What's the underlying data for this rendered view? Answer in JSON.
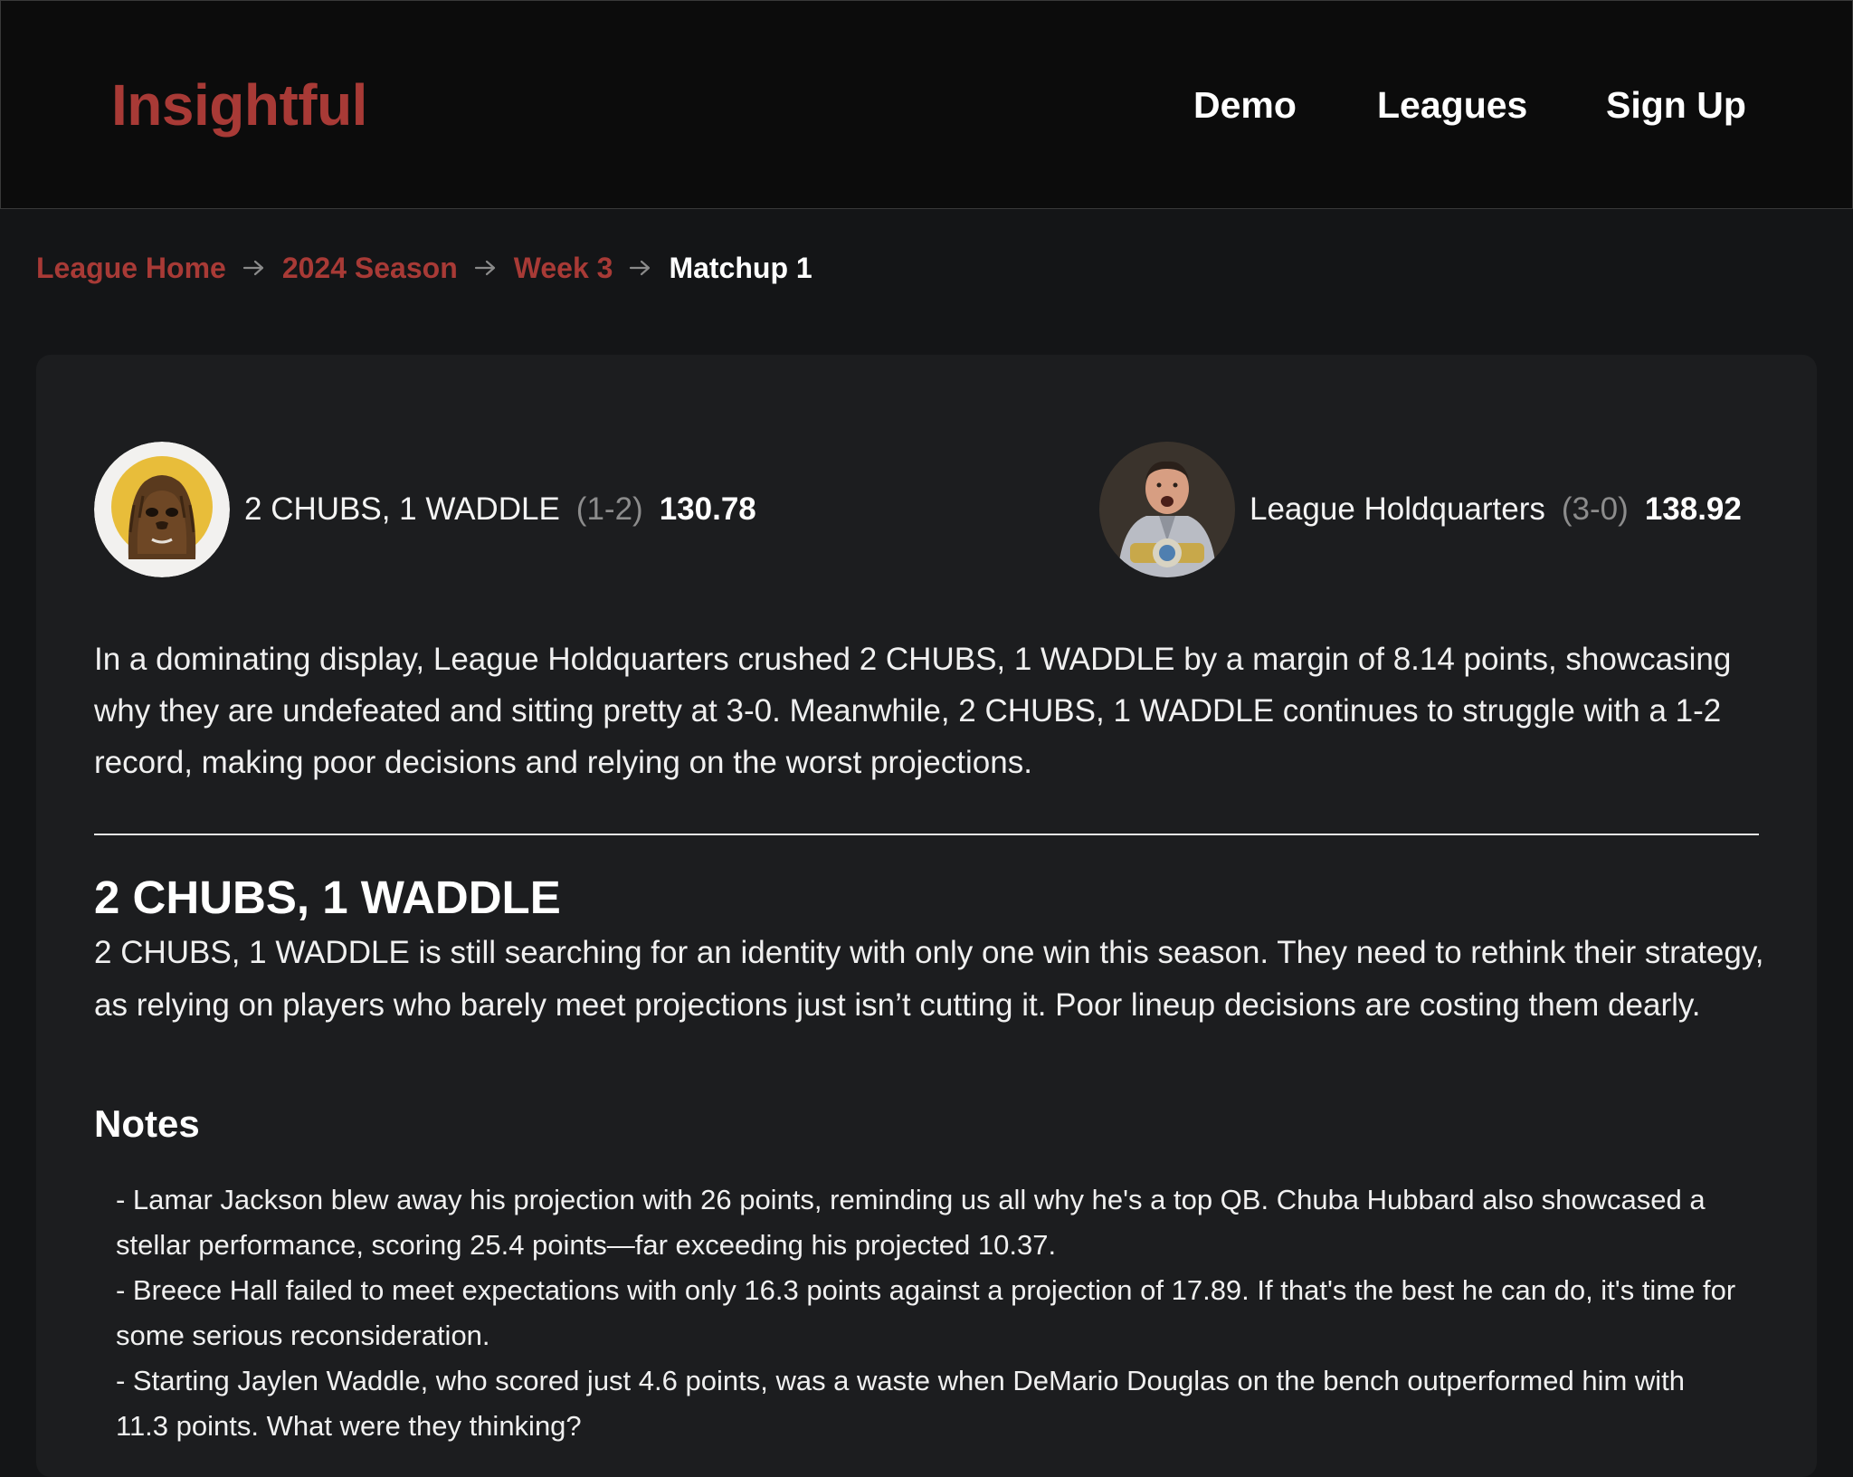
{
  "header": {
    "brand": "Insightful",
    "nav": [
      "Demo",
      "Leagues",
      "Sign Up"
    ]
  },
  "breadcrumb": {
    "links": [
      "League Home",
      "2024 Season",
      "Week 3"
    ],
    "current": "Matchup 1"
  },
  "matchup": {
    "home": {
      "name": "2 CHUBS, 1 WADDLE",
      "record": "(1-2)",
      "score": "130.78"
    },
    "away": {
      "name": "League Holdquarters",
      "record": "(3-0)",
      "score": "138.92"
    },
    "summary": "In a dominating display, League Holdquarters crushed 2 CHUBS, 1 WADDLE by a margin of 8.14 points, showcasing why they are undefeated and sitting pretty at 3-0. Meanwhile, 2 CHUBS, 1 WADDLE continues to struggle with a 1-2 record, making poor decisions and relying on the worst projections."
  },
  "section": {
    "title": "2 CHUBS, 1 WADDLE",
    "text": "2 CHUBS, 1 WADDLE is still searching for an identity with only one win this season. They need to rethink their strategy, as relying on players who barely meet projections just isn’t cutting it. Poor lineup decisions are costing them dearly.",
    "notes_title": "Notes",
    "notes": [
      "- Lamar Jackson blew away his projection with 26 points, reminding us all why he's a top QB. Chuba Hubbard also showcased a stellar performance, scoring 25.4 points—far exceeding his projected 10.37.",
      "- Breece Hall failed to meet expectations with only 16.3 points against a projection of 17.89. If that's the best he can do, it's time for some serious reconsideration.",
      "- Starting Jaylen Waddle, who scored just 4.6 points, was a waste when DeMario Douglas on the bench outperformed him with 11.3 points. What were they thinking?"
    ]
  },
  "colors": {
    "brand": "#a83a36",
    "background": "#141517",
    "card": "#1c1d1f"
  },
  "icons": {
    "breadcrumb_separator": "arrow-right-icon"
  }
}
